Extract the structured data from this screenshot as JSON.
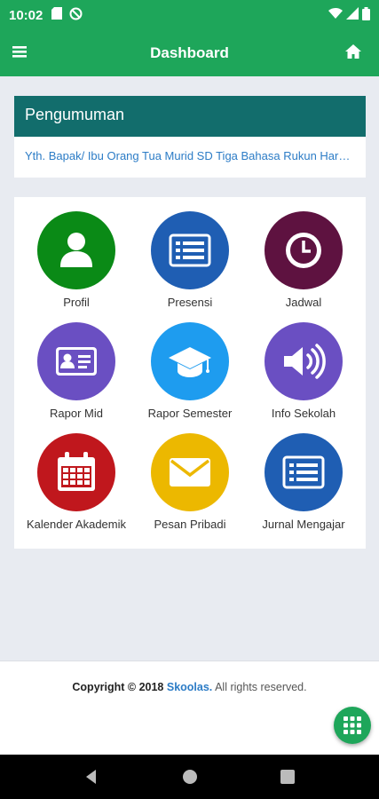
{
  "status_bar": {
    "time": "10:02"
  },
  "header": {
    "title": "Dashboard"
  },
  "announcement": {
    "title": "Pengumuman",
    "text": "Yth. Bapak/ Ibu Orang Tua Murid SD Tiga Bahasa Rukun Harapan"
  },
  "menu": {
    "items": [
      {
        "label": "Profil",
        "icon": "user-icon",
        "color": "#0a8a16"
      },
      {
        "label": "Presensi",
        "icon": "list-card-icon",
        "color": "#1f5eb3"
      },
      {
        "label": "Jadwal",
        "icon": "clock-icon",
        "color": "#5e1240"
      },
      {
        "label": "Rapor Mid",
        "icon": "id-card-icon",
        "color": "#6a4fc2"
      },
      {
        "label": "Rapor Semester",
        "icon": "graduation-cap-icon",
        "color": "#1e9cef"
      },
      {
        "label": "Info Sekolah",
        "icon": "speaker-icon",
        "color": "#6a4fc2"
      },
      {
        "label": "Kalender Akademik",
        "icon": "calendar-icon",
        "color": "#c0171d"
      },
      {
        "label": "Pesan Pribadi",
        "icon": "envelope-icon",
        "color": "#ecb800"
      },
      {
        "label": "Jurnal Mengajar",
        "icon": "list-card-icon",
        "color": "#1f5eb3"
      }
    ]
  },
  "footer": {
    "copyright": "Copyright © 2018",
    "brand": "Skoolas.",
    "rights": "All rights reserved."
  },
  "colors": {
    "primary": "#1ea65a",
    "announce_header": "#126d6c",
    "link": "#2c7cc6"
  }
}
